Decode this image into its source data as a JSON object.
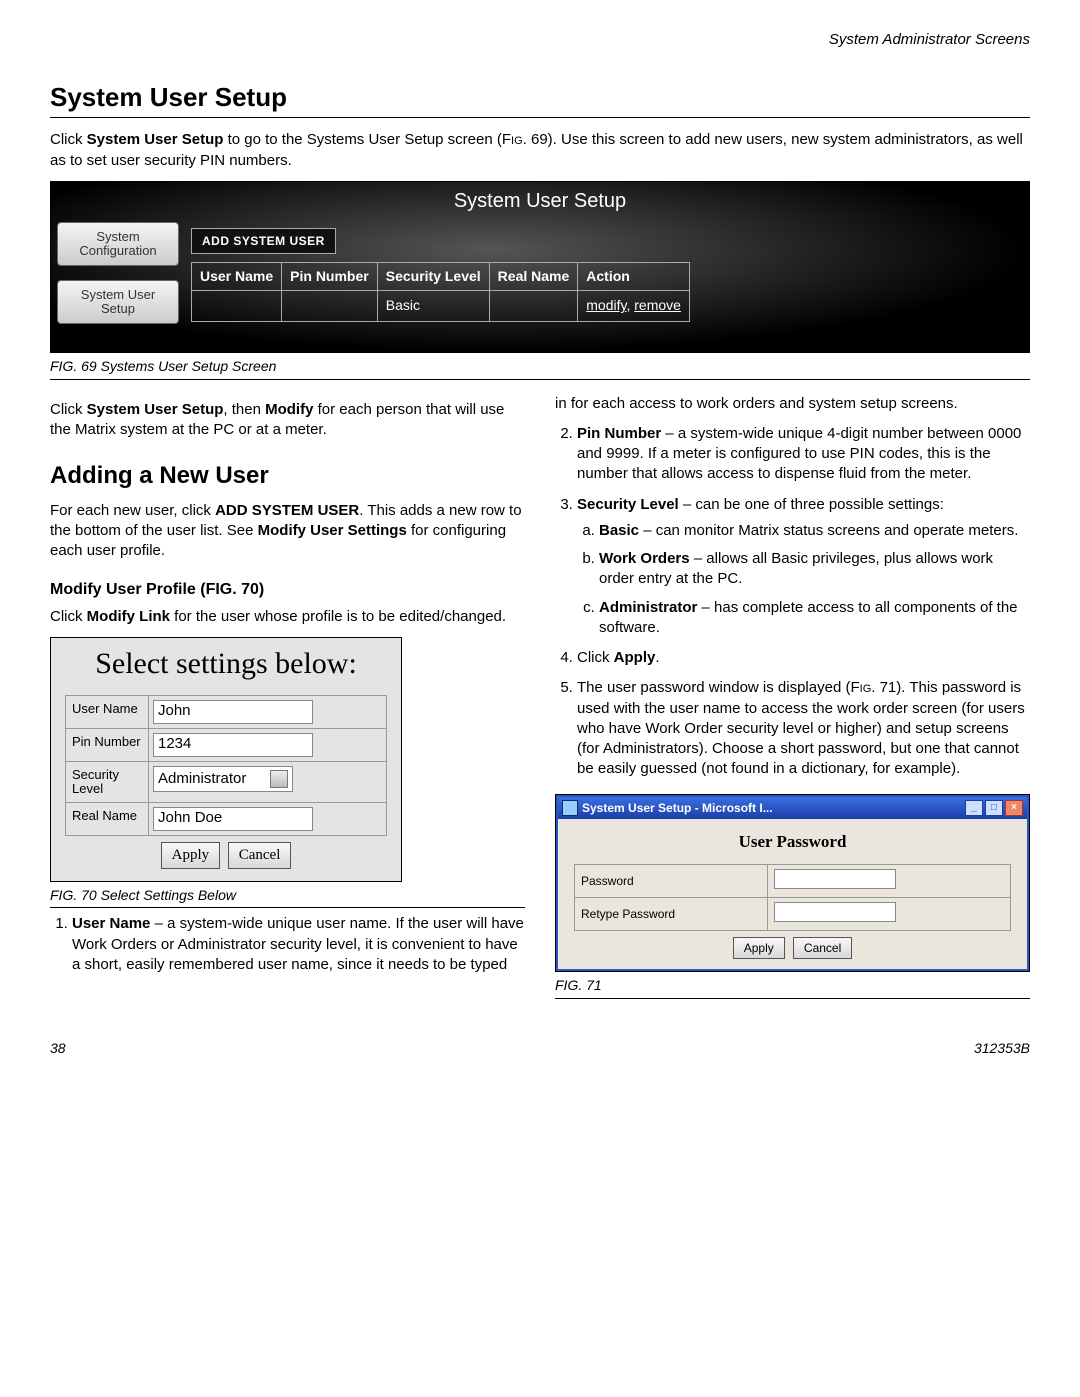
{
  "header": {
    "section": "System Administrator Screens"
  },
  "title1": "System User Setup",
  "intro": {
    "pre": "Click ",
    "bold1": "System User Setup",
    "mid": " to go to the Systems User Setup screen (",
    "figref": "Fig.",
    "fignum": " 69). Use this screen to add new users, new system administrators, as well as to set user security PIN numbers."
  },
  "fig69": {
    "title": "System User Setup",
    "side1": "System Configuration",
    "side2": "System User Setup",
    "addbtn": "ADD SYSTEM USER",
    "cols": [
      "User Name",
      "Pin Number",
      "Security Level",
      "Real Name",
      "Action"
    ],
    "row": {
      "security": "Basic",
      "modify": "modify",
      "remove": "remove"
    },
    "caption": "FIG. 69 Systems User Setup Screen"
  },
  "leftcol": {
    "p1": {
      "a": "Click ",
      "b": "System User Setup",
      "c": ", then ",
      "d": "Modify",
      "e": " for each person that will use the Matrix system at the PC or at a meter."
    },
    "h2": "Adding a New User",
    "p2": {
      "a": "For each new user, click ",
      "b": "ADD SYSTEM USER",
      "c": ". This adds a new row to the bottom of the user list. See ",
      "d": "Modify User Settings",
      "e": " for configuring each user profile."
    },
    "h3": "Modify User Profile (FIG. 70)",
    "p3": {
      "a": "Click ",
      "b": "Modify Link",
      "c": " for the user whose profile is to be edited/changed."
    },
    "li1": {
      "b": "User Name",
      "t": " – a system-wide unique user name. If the user will have Work Orders or Administrator security level, it is convenient to have a short, easily remembered user name, since it needs to be typed"
    }
  },
  "fig70": {
    "title": "Select settings below:",
    "rows": {
      "username_label": "User Name",
      "username_val": "John",
      "pin_label": "Pin Number",
      "pin_val": "1234",
      "sec_label": "Security Level",
      "sec_val": "Administrator",
      "real_label": "Real Name",
      "real_val": "John Doe"
    },
    "apply": "Apply",
    "cancel": "Cancel",
    "caption": "FIG. 70 Select Settings Below"
  },
  "rightcol": {
    "cont": "in for each access to work orders and system setup screens.",
    "li2": {
      "b": "Pin Number",
      "t": " – a system-wide unique 4-digit number between 0000 and 9999. If a meter is configured to use PIN codes, this is the number that allows access to dispense fluid from the meter."
    },
    "li3": {
      "b": "Security Level",
      "t": " – can be one of three possible settings:"
    },
    "li3a": {
      "b": "Basic",
      "t": " – can monitor Matrix status screens and operate meters."
    },
    "li3b": {
      "b": "Work Orders",
      "t": " – allows all Basic privileges, plus allows work order entry at the PC."
    },
    "li3c": {
      "b": "Administrator",
      "t": " – has complete access to all components of the software."
    },
    "li4": {
      "a": "Click ",
      "b": "Apply",
      "c": "."
    },
    "li5": {
      "a": "The user password window is displayed (",
      "fr": "Fig.",
      "n": " 71). This password is used with the user name to access the work order screen (for users who have Work Order security level or higher) and setup screens (for Administrators). Choose a short password, but one that cannot be easily guessed (not found in a dictionary, for example)."
    }
  },
  "fig71": {
    "wintitle": "System User Setup - Microsoft I...",
    "heading": "User Password",
    "pw_label": "Password",
    "re_label": "Retype Password",
    "apply": "Apply",
    "cancel": "Cancel",
    "caption": "FIG. 71"
  },
  "footer": {
    "page": "38",
    "doc": "312353B"
  }
}
